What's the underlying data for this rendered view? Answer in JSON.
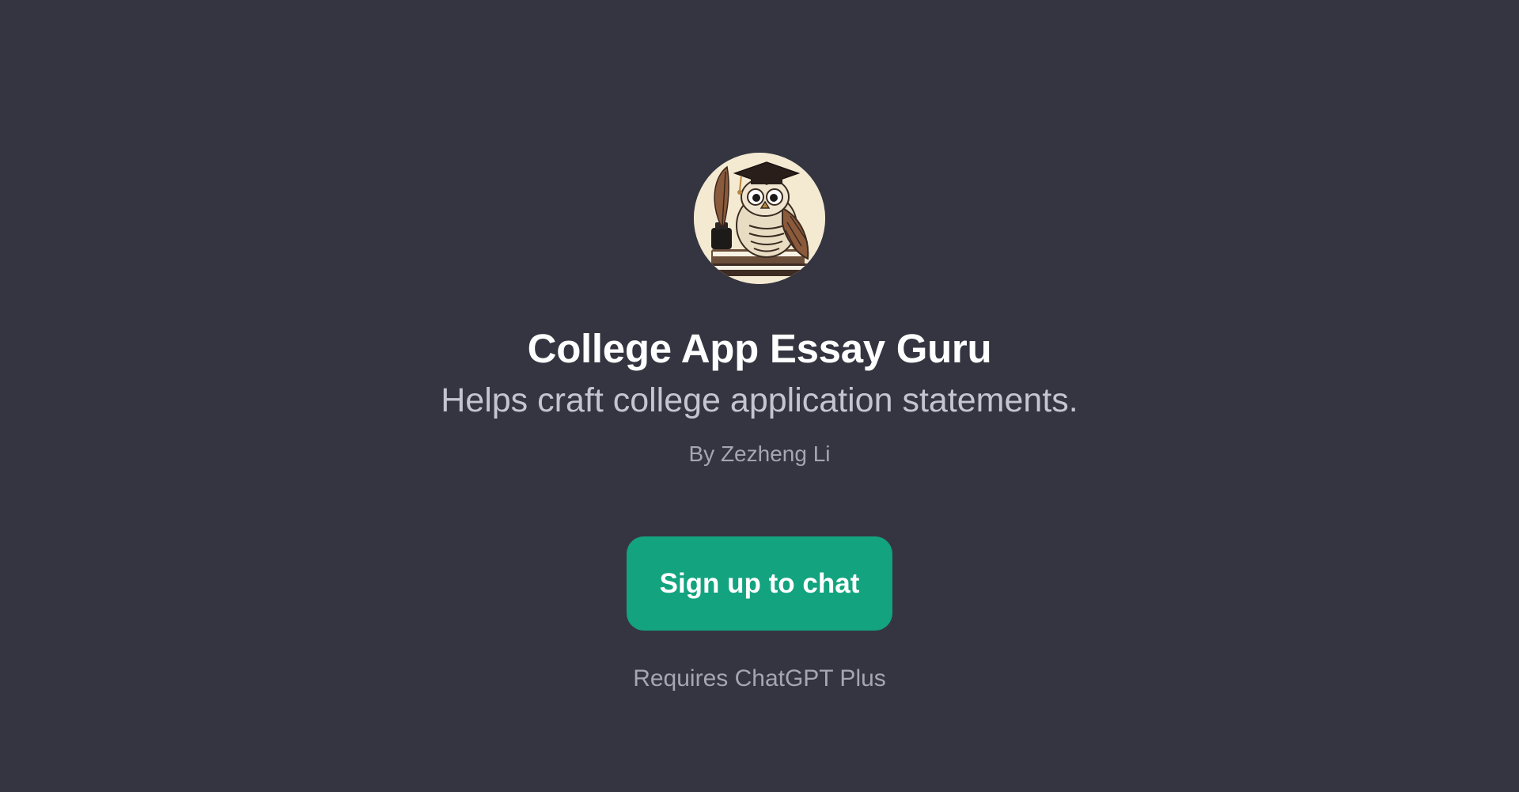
{
  "gpt": {
    "avatar_icon": "owl-graduate-avatar-icon",
    "title": "College App Essay Guru",
    "description": "Helps craft college application statements.",
    "author": "By Zezheng Li"
  },
  "actions": {
    "signup_label": "Sign up to chat",
    "requirement_note": "Requires ChatGPT Plus"
  },
  "colors": {
    "background": "#353541",
    "button": "#13a37f",
    "title_text": "#ffffff",
    "muted_text": "#a6a6b3"
  }
}
